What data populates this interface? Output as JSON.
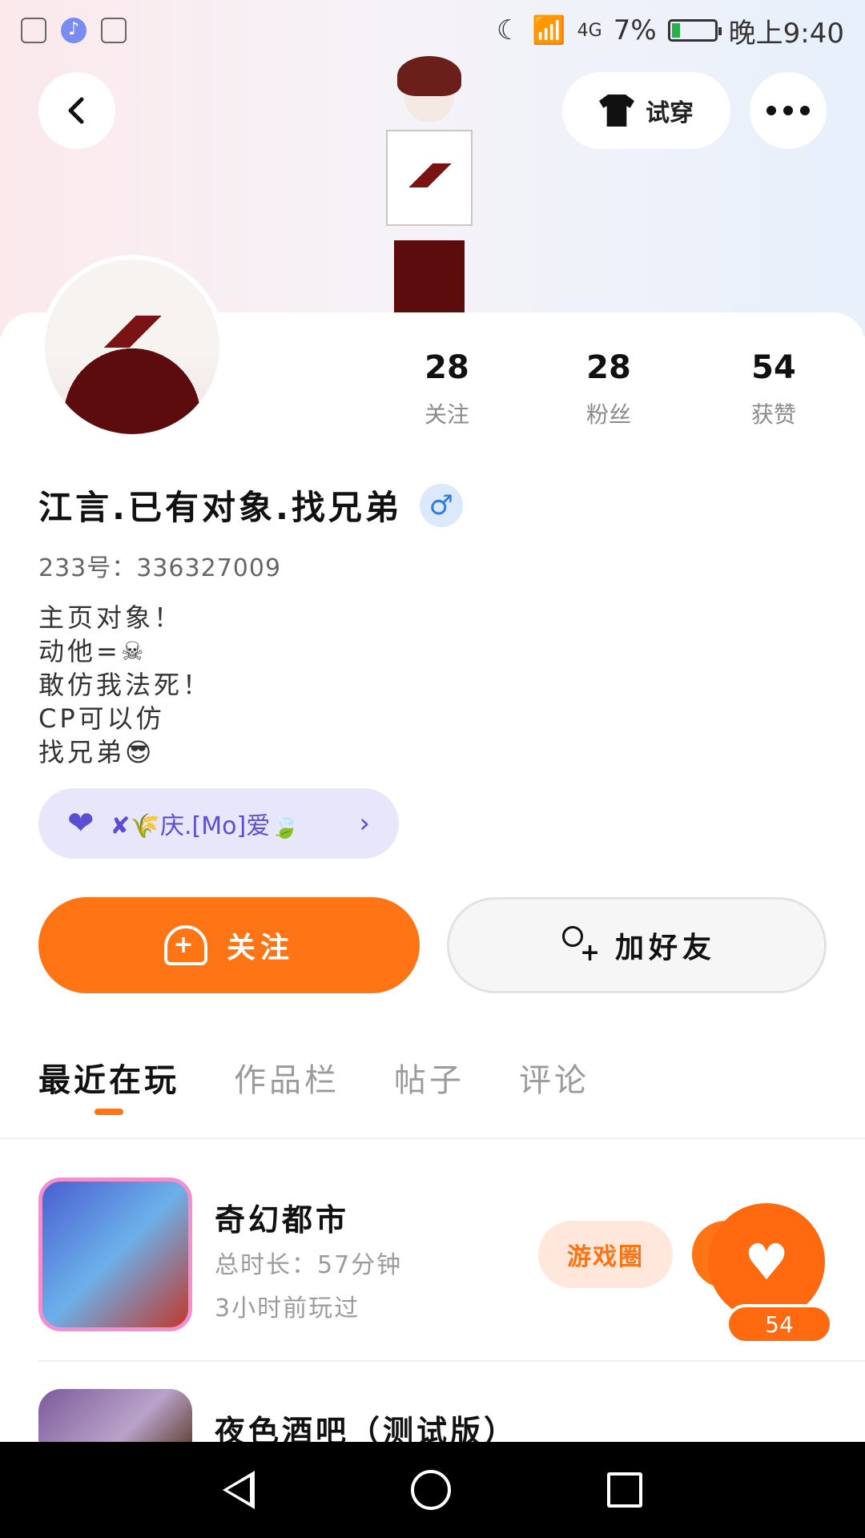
{
  "status_bar": {
    "network": "4G",
    "battery": "7%",
    "time": "晚上9:40"
  },
  "header": {
    "try_on_label": "试穿"
  },
  "profile": {
    "stats": [
      {
        "value": "28",
        "label": "关注"
      },
      {
        "value": "28",
        "label": "粉丝"
      },
      {
        "value": "54",
        "label": "获赞"
      }
    ],
    "name": "江言.已有对象.找兄弟",
    "gender_symbol": "♂",
    "id_line": "233号：336327009",
    "bio": [
      "主页对象！",
      "动他=☠",
      "敢仿我法死！",
      "CP可以仿",
      "找兄弟😎"
    ],
    "cp_label": "✘🌾庆.[Mo]爱🍃"
  },
  "actions": {
    "follow_label": "关注",
    "add_friend_label": "加好友"
  },
  "tabs": [
    "最近在玩",
    "作品栏",
    "帖子",
    "评论"
  ],
  "games": [
    {
      "title": "奇幻都市",
      "duration": "总时长：57分钟",
      "last_played": "3小时前玩过",
      "tag": "游戏圈"
    },
    {
      "title": "夜色酒吧（测试版）"
    }
  ],
  "like_fab": {
    "count": "54"
  },
  "colors": {
    "accent": "#ff7415",
    "cp_pill": "#e8e6fb",
    "male_badge": "#2f7de0"
  }
}
